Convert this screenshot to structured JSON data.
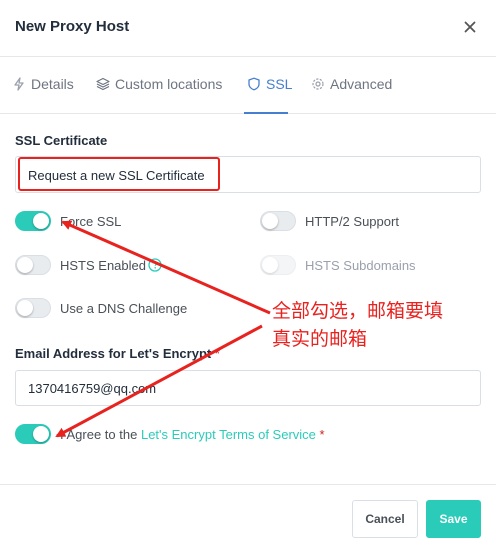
{
  "modal": {
    "title": "New Proxy Host",
    "close_icon": "close-icon"
  },
  "tabs": [
    {
      "label": "Details",
      "icon": "lightning-icon",
      "active": false
    },
    {
      "label": "Custom locations",
      "icon": "layers-icon",
      "active": false
    },
    {
      "label": "SSL",
      "icon": "shield-icon",
      "active": true
    },
    {
      "label": "Advanced",
      "icon": "gear-icon",
      "active": false
    }
  ],
  "ssl": {
    "cert_label": "SSL Certificate",
    "cert_value": "Request a new SSL Certificate",
    "force_ssl": {
      "label": "Force SSL",
      "on": true
    },
    "http2": {
      "label": "HTTP/2 Support",
      "on": false
    },
    "hsts": {
      "label": "HSTS Enabled",
      "on": false
    },
    "hsts_sub": {
      "label": "HSTS Subdomains",
      "on": false,
      "disabled": true
    },
    "dns": {
      "label": "Use a DNS Challenge",
      "on": false
    },
    "email_label": "Email Address for Let's Encrypt",
    "required_mark": "*",
    "email_value": "1370416759@qq.com",
    "agree_prefix": "I Agree to the",
    "agree_link": "Let's Encrypt Terms of Service",
    "agree_on": true
  },
  "footer": {
    "cancel_label": "Cancel",
    "save_label": "Save"
  },
  "annotation": {
    "line1": "全部勾选，邮箱要填",
    "line2": "真实的邮箱"
  },
  "colors": {
    "accent": "#2bcbba",
    "active_tab": "#467fcf",
    "annotation_red": "#e8231f"
  }
}
